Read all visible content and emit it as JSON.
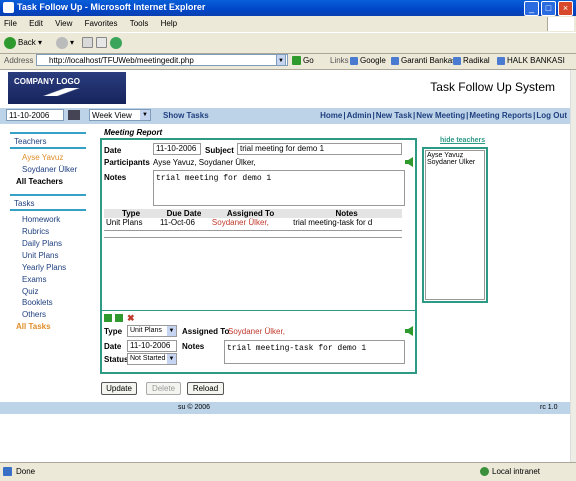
{
  "window": {
    "title": "Task Follow Up - Microsoft Internet Explorer"
  },
  "menu": [
    "File",
    "Edit",
    "View",
    "Favorites",
    "Tools",
    "Help"
  ],
  "toolbar": {
    "back": "Back",
    "go": "Go",
    "links_label": "Links"
  },
  "address": {
    "label": "Address",
    "url": "http://localhost/TFUWeb/meetingedit.php"
  },
  "links": [
    "Google",
    "Garanti Bankasi",
    "Radikal",
    "HALK BANKASI"
  ],
  "app": {
    "logo": "COMPANY LOGO",
    "title": "Task Follow Up System"
  },
  "nav": {
    "date": "11-10-2006",
    "view": "Week View",
    "show_tasks": "Show Tasks",
    "links": [
      "Home",
      "Admin",
      "New Task",
      "New Meeting",
      "Meeting Reports",
      "Log Out"
    ]
  },
  "sidebar": {
    "teachers_header": "Teachers",
    "teachers": [
      "Ayse Yavuz",
      "Soydaner Ülker"
    ],
    "all_teachers": "All Teachers",
    "tasks_header": "Tasks",
    "tasks": [
      "Homework",
      "Rubrics",
      "Daily Plans",
      "Unit Plans",
      "Yearly Plans",
      "Exams",
      "Quiz",
      "Booklets",
      "Others"
    ],
    "all_tasks": "All Tasks"
  },
  "report": {
    "title": "Meeting Report",
    "date_label": "Date",
    "date": "11-10-2006",
    "subject_label": "Subject",
    "subject": "trial meeting for demo 1",
    "participants_label": "Participants",
    "participants": "Ayse Yavuz, Soydaner Ülker,",
    "notes_label": "Notes",
    "notes": "trial meeting for demo 1",
    "table": {
      "headers": [
        "Type",
        "Due Date",
        "Assigned To",
        "Notes"
      ],
      "rows": [
        {
          "type": "Unit Plans",
          "due": "11-Oct-06",
          "assigned": "Soydaner Ülker,",
          "notes": "trial meeting-task for d"
        }
      ]
    },
    "task_form": {
      "type_label": "Type",
      "type": "Unit Plans",
      "assigned_label": "Assigned To",
      "assigned": "Soydaner Ülker,",
      "date_label": "Date",
      "date": "11-10-2006",
      "notes_label": "Notes",
      "notes": "trial meeting-task for demo 1",
      "status_label": "Status",
      "status": "Not Started"
    },
    "buttons": {
      "update": "Update",
      "delete": "Delete",
      "reload": "Reload"
    }
  },
  "teachers_panel": {
    "hide": "hide teachers",
    "items": [
      "Ayse Yavuz",
      "Soydaner Ülker"
    ]
  },
  "footer": {
    "copyright": "su © 2006",
    "version": "rc 1.0"
  },
  "status": {
    "done": "Done",
    "zone": "Local intranet"
  }
}
